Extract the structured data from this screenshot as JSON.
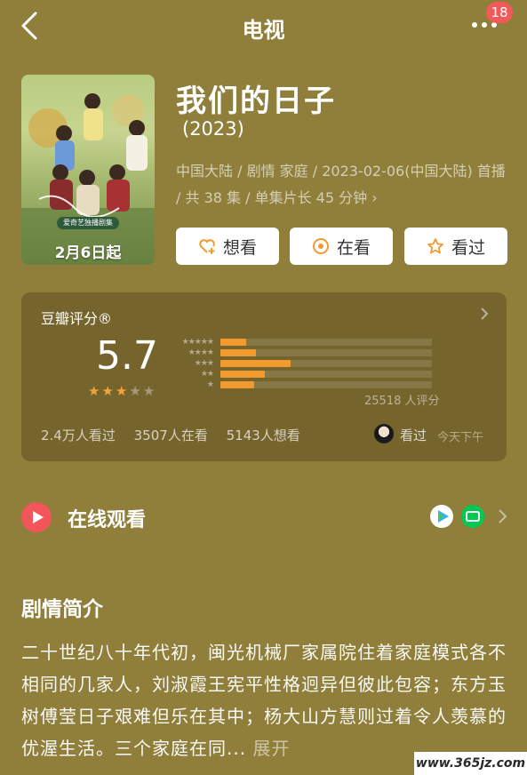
{
  "nav": {
    "title": "电视",
    "notification_count": "18"
  },
  "poster": {
    "tag_text": "爱奇艺独播剧集",
    "date_text": "2月6日起"
  },
  "movie": {
    "title": "我们的日子",
    "year": "(2023)",
    "meta": "中国大陆 / 剧情 家庭 / 2023-02-06(中国大陆) 首播 / 共 38 集 / 单集片长 45 分钟"
  },
  "actions": {
    "want": "想看",
    "watching": "在看",
    "watched": "看过"
  },
  "rating": {
    "title": "豆瓣评分®",
    "score": "5.7",
    "stars_filled": 3,
    "stars_total": 5,
    "distribution": [
      {
        "stars": "★★★★★",
        "fraction": 0.12
      },
      {
        "stars": "★★★★",
        "fraction": 0.17
      },
      {
        "stars": "★★★",
        "fraction": 0.33
      },
      {
        "stars": "★★",
        "fraction": 0.21
      },
      {
        "stars": "★",
        "fraction": 0.16
      }
    ],
    "count": "25518 人评分",
    "stats": [
      "2.4万人看过",
      "3507人在看",
      "5143人想看"
    ],
    "friend_label": "看过",
    "friend_time": "今天下午"
  },
  "online": {
    "label": "在线观看"
  },
  "synopsis": {
    "title": "剧情简介",
    "text": "二十世纪八十年代初，闽光机械厂家属院住着家庭模式各不相同的几家人，刘淑霞王宪平性格迥异但彼此包容；东方玉树傅莹日子艰难但乐在其中；杨大山方慧则过着令人羡慕的优渥生活。三个家庭在同...",
    "expand": "展开"
  },
  "watermark": "www.365jz.com",
  "colors": {
    "background": "#8f7f3b",
    "accent": "#f29a2e",
    "badge": "#f25a5a"
  }
}
